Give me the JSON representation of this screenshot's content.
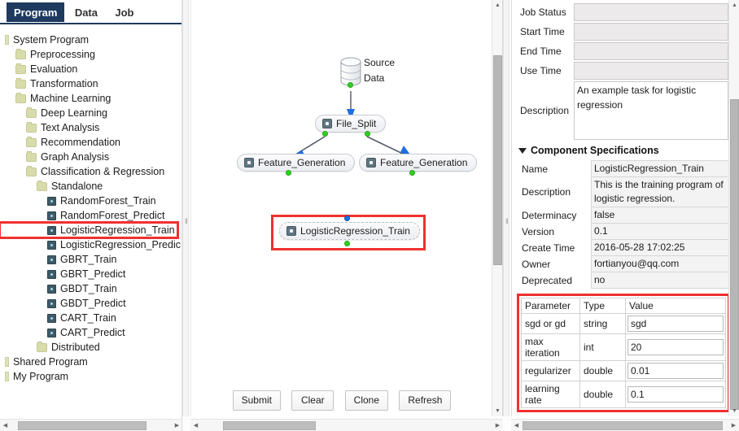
{
  "tabs": [
    {
      "label": "Program",
      "active": true
    },
    {
      "label": "Data",
      "active": false
    },
    {
      "label": "Job",
      "active": false
    }
  ],
  "tree": [
    {
      "label": "System Program",
      "indent": 0,
      "kind": "root"
    },
    {
      "label": "Preprocessing",
      "indent": 1,
      "kind": "folder"
    },
    {
      "label": "Evaluation",
      "indent": 1,
      "kind": "folder"
    },
    {
      "label": "Transformation",
      "indent": 1,
      "kind": "folder"
    },
    {
      "label": "Machine Learning",
      "indent": 1,
      "kind": "folder"
    },
    {
      "label": "Deep Learning",
      "indent": 2,
      "kind": "folder"
    },
    {
      "label": "Text Analysis",
      "indent": 2,
      "kind": "folder"
    },
    {
      "label": "Recommendation",
      "indent": 2,
      "kind": "folder"
    },
    {
      "label": "Graph Analysis",
      "indent": 2,
      "kind": "folder"
    },
    {
      "label": "Classification & Regression",
      "indent": 2,
      "kind": "folder"
    },
    {
      "label": "Standalone",
      "indent": 3,
      "kind": "folder"
    },
    {
      "label": "RandomForest_Train",
      "indent": 4,
      "kind": "leaf"
    },
    {
      "label": "RandomForest_Predict",
      "indent": 4,
      "kind": "leaf"
    },
    {
      "label": "LogisticRegression_Train",
      "indent": 4,
      "kind": "leaf",
      "selected": true
    },
    {
      "label": "LogisticRegression_Predic",
      "indent": 4,
      "kind": "leaf"
    },
    {
      "label": "GBRT_Train",
      "indent": 4,
      "kind": "leaf"
    },
    {
      "label": "GBRT_Predict",
      "indent": 4,
      "kind": "leaf"
    },
    {
      "label": "GBDT_Train",
      "indent": 4,
      "kind": "leaf"
    },
    {
      "label": "GBDT_Predict",
      "indent": 4,
      "kind": "leaf"
    },
    {
      "label": "CART_Train",
      "indent": 4,
      "kind": "leaf"
    },
    {
      "label": "CART_Predict",
      "indent": 4,
      "kind": "leaf"
    },
    {
      "label": "Distributed",
      "indent": 3,
      "kind": "folder"
    },
    {
      "label": "Shared Program",
      "indent": 0,
      "kind": "root"
    },
    {
      "label": "My Program",
      "indent": 0,
      "kind": "root"
    }
  ],
  "canvas": {
    "source_label_line1": "Source",
    "source_label_line2": "Data",
    "nodes": [
      {
        "id": "file_split",
        "label": "File_Split"
      },
      {
        "id": "feature_generation_left",
        "label": "Feature_Generation"
      },
      {
        "id": "feature_generation_right",
        "label": "Feature_Generation"
      },
      {
        "id": "logistic_regression_train",
        "label": "LogisticRegression_Train",
        "selected": true
      }
    ],
    "buttons": [
      {
        "label": "Submit"
      },
      {
        "label": "Clear"
      },
      {
        "label": "Clone"
      },
      {
        "label": "Refresh"
      }
    ]
  },
  "right_panel": {
    "job_fields": [
      {
        "label": "Job Status",
        "value": ""
      },
      {
        "label": "Start Time",
        "value": ""
      },
      {
        "label": "End Time",
        "value": ""
      },
      {
        "label": "Use Time",
        "value": ""
      }
    ],
    "description_label": "Description",
    "description_value": "An example task for logistic regression",
    "section_title": "Component Specifications",
    "specs": [
      {
        "key": "Name",
        "value": "LogisticRegression_Train"
      },
      {
        "key": "Description",
        "value": "This is the training program of logistic regression."
      },
      {
        "key": "Determinacy",
        "value": "false"
      },
      {
        "key": "Version",
        "value": "0.1"
      },
      {
        "key": "Create Time",
        "value": "2016-05-28 17:02:25"
      },
      {
        "key": "Owner",
        "value": "fortianyou@qq.com"
      },
      {
        "key": "Deprecated",
        "value": "no"
      }
    ],
    "param_headers": [
      "Parameter",
      "Type",
      "Value"
    ],
    "params": [
      {
        "name": "sgd or gd",
        "type": "string",
        "value": "sgd"
      },
      {
        "name": "max iteration",
        "type": "int",
        "value": "20"
      },
      {
        "name": "regularizer",
        "type": "double",
        "value": "0.01"
      },
      {
        "name": "learning rate",
        "type": "double",
        "value": "0.1"
      }
    ]
  },
  "colors": {
    "tab_active_bg": "#1e3a5f",
    "highlight_red": "#f03030",
    "port_out_green": "#2fd11f",
    "port_in_blue": "#1f6fe0",
    "folder_icon": "#d8dcab",
    "leaf_icon": "#3e5c68"
  }
}
